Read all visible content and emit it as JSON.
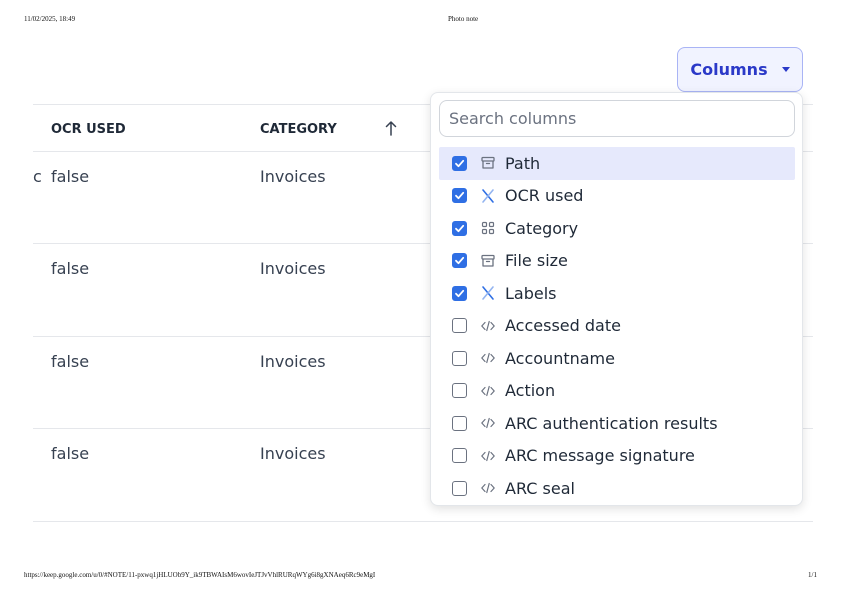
{
  "print": {
    "datetime": "11/02/2025, 18:49",
    "title": "Photo note",
    "url": "https://keep.google.com/u/0/#NOTE/11-pxwq1jHLUOb9Y_ik9TBWAIsM6wovIeJTJvVhlRURqWYg6i8gXNAeq6Rc9eMgI",
    "page": "1/1"
  },
  "toolbar": {
    "columns_label": "Columns"
  },
  "table": {
    "headers": {
      "ocr_used": "OCR USED",
      "category": "CATEGORY"
    },
    "cut_char": "c",
    "rows": [
      {
        "ocr_used": "false",
        "category": "Invoices"
      },
      {
        "ocr_used": "false",
        "category": "Invoices"
      },
      {
        "ocr_used": "false",
        "category": "Invoices"
      },
      {
        "ocr_used": "false",
        "category": "Invoices"
      }
    ]
  },
  "column_picker": {
    "search_placeholder": "Search columns",
    "items": [
      {
        "label": "Path",
        "checked": true,
        "icon": "archive-icon"
      },
      {
        "label": "OCR used",
        "checked": true,
        "icon": "boolean-icon"
      },
      {
        "label": "Category",
        "checked": true,
        "icon": "grid-icon"
      },
      {
        "label": "File size",
        "checked": true,
        "icon": "archive-icon"
      },
      {
        "label": "Labels",
        "checked": true,
        "icon": "boolean-icon"
      },
      {
        "label": "Accessed date",
        "checked": false,
        "icon": "code-icon"
      },
      {
        "label": "Accountname",
        "checked": false,
        "icon": "code-icon"
      },
      {
        "label": "Action",
        "checked": false,
        "icon": "code-icon"
      },
      {
        "label": "ARC authentication results",
        "checked": false,
        "icon": "code-icon"
      },
      {
        "label": "ARC message signature",
        "checked": false,
        "icon": "code-icon"
      },
      {
        "label": "ARC seal",
        "checked": false,
        "icon": "code-icon"
      }
    ]
  },
  "colors": {
    "accent": "#2f6fe4",
    "button_text": "#2b39c8",
    "highlight": "#e6e9fc"
  }
}
